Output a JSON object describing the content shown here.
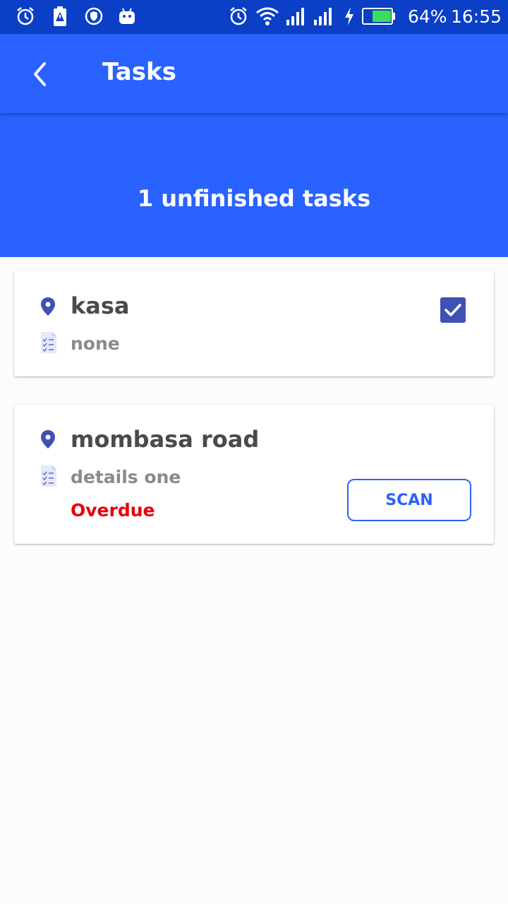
{
  "status_bar": {
    "battery_percent": "64%",
    "time": "16:55",
    "left_icons": [
      "alarm-icon",
      "battery-alert-icon",
      "shield-icon",
      "android-icon"
    ],
    "right_icons": [
      "alarm-icon",
      "wifi-icon",
      "signal-icon",
      "signal-icon",
      "charging-icon",
      "battery-icon"
    ]
  },
  "app_bar": {
    "title": "Tasks",
    "back_icon": "chevron-left-icon"
  },
  "hero": {
    "summary": "1 unfinished tasks"
  },
  "tasks": [
    {
      "location": "kasa",
      "details": "none",
      "checked": true
    },
    {
      "location": "mombasa road",
      "details": "details one",
      "status": "Overdue",
      "action_label": "SCAN"
    }
  ],
  "colors": {
    "status_bar": "#0a3fc6",
    "primary": "#2962ff",
    "checkbox": "#3f51b5",
    "overdue": "#e8000b",
    "title_text": "#4a4a4a",
    "detail_text": "#8a8a8a"
  }
}
